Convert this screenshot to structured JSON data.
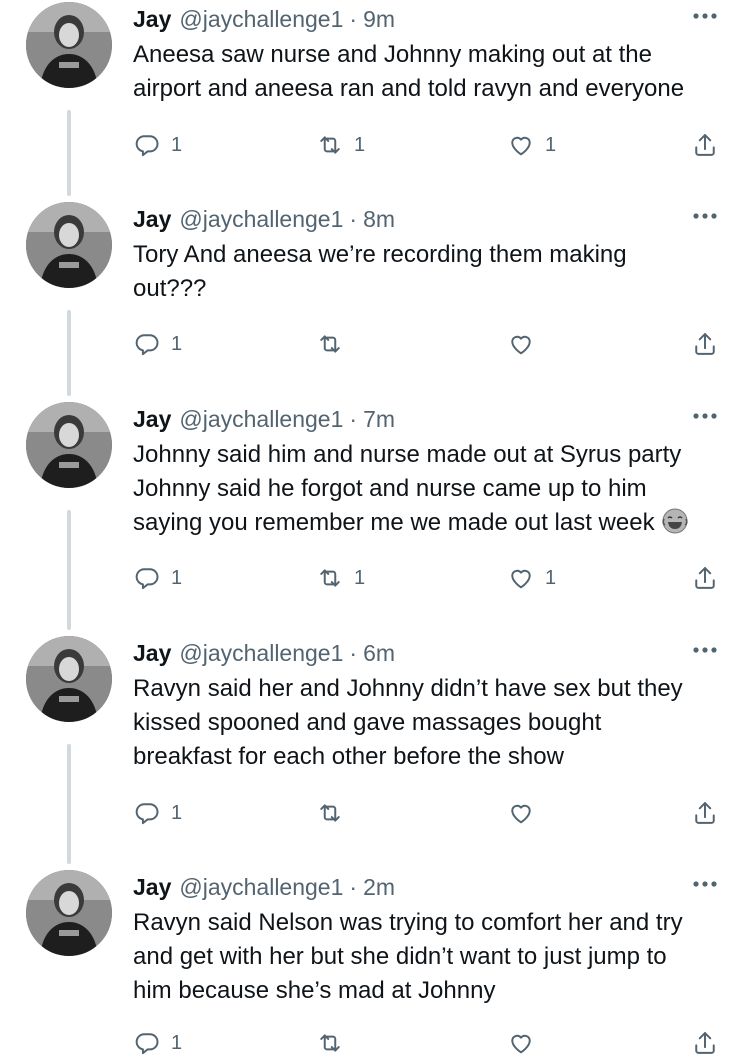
{
  "tweets": [
    {
      "name": "Jay",
      "handle": "@jaychallenge1",
      "separator": "·",
      "time": "9m",
      "lines": [
        "Aneesa saw nurse and Johnny making out at the",
        "airport and aneesa ran and told ravyn and everyone"
      ],
      "reply_count": "1",
      "retweet_count": "1",
      "like_count": "1"
    },
    {
      "name": "Jay",
      "handle": "@jaychallenge1",
      "separator": "·",
      "time": "8m",
      "lines": [
        "Tory And aneesa we’re recording them making",
        "out???"
      ],
      "reply_count": "1",
      "retweet_count": "",
      "like_count": ""
    },
    {
      "name": "Jay",
      "handle": "@jaychallenge1",
      "separator": "·",
      "time": "7m",
      "lines": [
        "Johnny said him and nurse made out at Syrus party",
        "Johnny said he forgot and nurse came up to him",
        "saying you remember me we made out last week"
      ],
      "emoji": "tears-of-joy-emoji",
      "reply_count": "1",
      "retweet_count": "1",
      "like_count": "1"
    },
    {
      "name": "Jay",
      "handle": "@jaychallenge1",
      "separator": "·",
      "time": "6m",
      "lines": [
        "Ravyn said her and Johnny didn’t have sex but they",
        "kissed spooned and gave massages bought",
        "breakfast for each other before the show"
      ],
      "reply_count": "1",
      "retweet_count": "",
      "like_count": ""
    },
    {
      "name": "Jay",
      "handle": "@jaychallenge1",
      "separator": "·",
      "time": "2m",
      "lines": [
        "Ravyn said Nelson was trying to comfort her and try",
        "and get with her but she didn’t want to just jump to",
        "him because she’s mad at Johnny"
      ],
      "reply_count": "1",
      "retweet_count": "",
      "like_count": ""
    }
  ],
  "icons": {
    "reply": "reply-icon",
    "retweet": "retweet-icon",
    "like": "heart-icon",
    "share": "share-icon",
    "more": "more-options-icon"
  },
  "colors": {
    "text": "#0f1419",
    "secondary": "#536471",
    "thread_line": "#cfd9de"
  }
}
